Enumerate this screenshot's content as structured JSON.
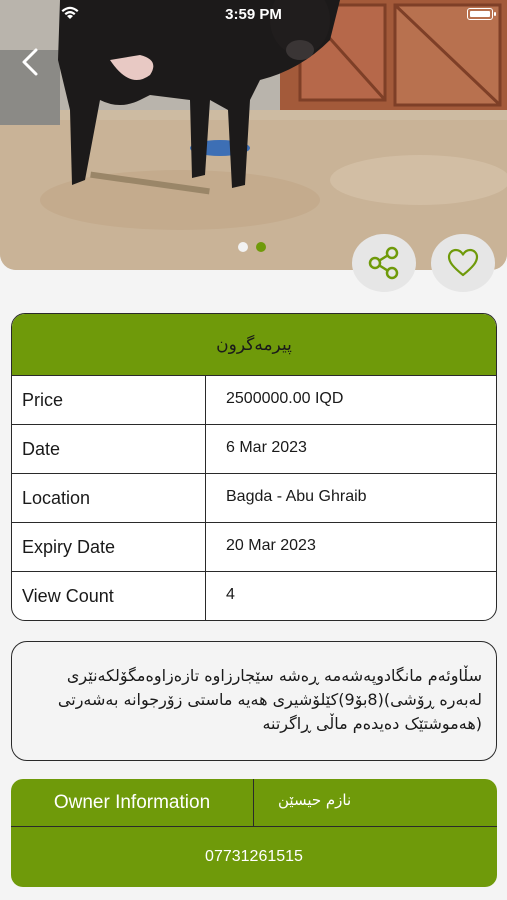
{
  "status_bar": {
    "time": "3:59 PM"
  },
  "gallery": {
    "active_index": 1,
    "count": 2
  },
  "listing": {
    "title": "پیرمەگرون",
    "rows": [
      {
        "label": "Price",
        "value": "2500000.00 IQD"
      },
      {
        "label": "Date",
        "value": "6 Mar 2023"
      },
      {
        "label": "Location",
        "value": "Bagda - Abu Ghraib"
      },
      {
        "label": "Expiry Date",
        "value": "20 Mar 2023"
      },
      {
        "label": "View Count",
        "value": "4"
      }
    ],
    "description": "سڵاوئەم مانگادوپەشەمە ڕەشە سێجارزاوە تازەزاوەمگۆلکەنێری لەبەرە ڕۆشی)(8بۆ9)کێلۆشیری هەیە ماستی زۆرجوانە بەشەرتی (هەموشتێک دەیدەم ماڵی ڕاگرتنە"
  },
  "owner": {
    "label": "Owner Information",
    "name": "نازم حیسێن",
    "phone": "07731261515"
  },
  "colors": {
    "accent": "#6f9a0a",
    "background": "#f4f4f4"
  },
  "icons": {
    "back": "chevron-left-icon",
    "share": "share-icon",
    "favorite": "heart-icon",
    "wifi": "wifi-icon",
    "battery": "battery-icon"
  }
}
